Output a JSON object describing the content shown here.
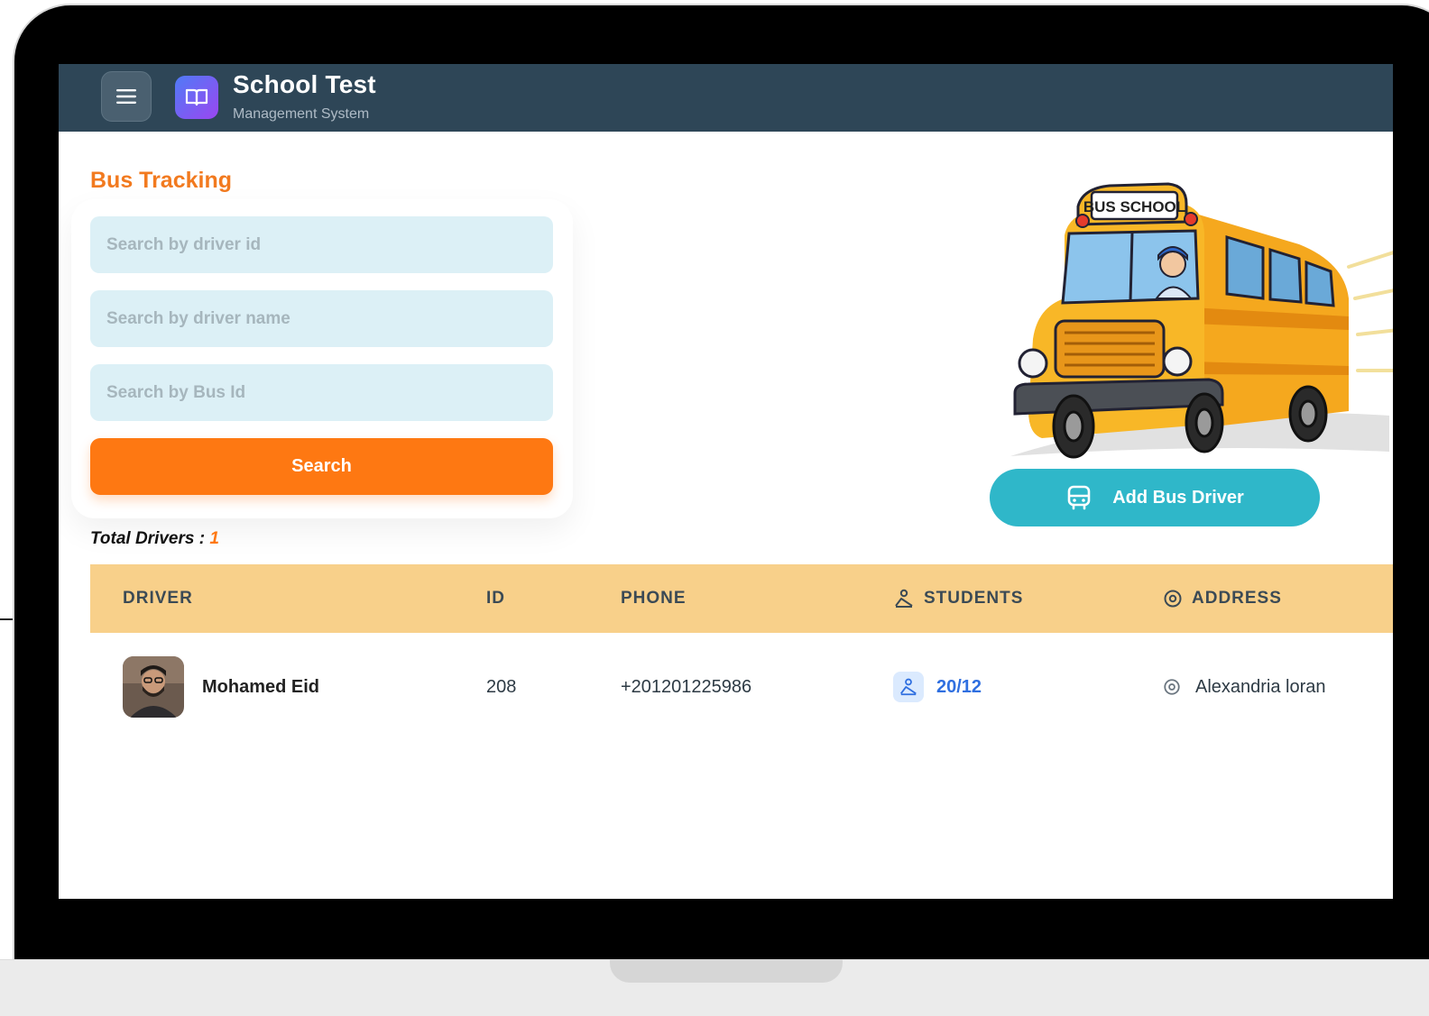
{
  "header": {
    "title": "School Test",
    "subtitle": "Management System"
  },
  "page": {
    "title": "Bus Tracking"
  },
  "search": {
    "driver_id_placeholder": "Search by driver id",
    "driver_name_placeholder": "Search by driver name",
    "bus_id_placeholder": "Search by Bus Id",
    "button_label": "Search"
  },
  "illustration": {
    "sign_text": "BUS SCHOOL"
  },
  "add_button": {
    "label": "Add Bus Driver"
  },
  "summary": {
    "total_label": "Total Drivers :",
    "total_count": "1"
  },
  "table": {
    "columns": [
      "DRIVER",
      "ID",
      "PHONE",
      "STUDENTS",
      "ADDRESS"
    ],
    "rows": [
      {
        "driver": "Mohamed Eid",
        "id": "208",
        "phone": "+201201225986",
        "students": "20/12",
        "address": "Alexandria loran"
      }
    ]
  },
  "icons": {
    "menu": "menu-icon",
    "logo": "book-icon",
    "bus": "bus-icon",
    "students": "students-icon",
    "address": "location-pin-icon"
  },
  "colors": {
    "header_bg": "#2e4657",
    "accent_orange": "#fe7812",
    "title_orange": "#f27a1f",
    "teal_button": "#2fb7c9",
    "table_head": "#f8d08a",
    "input_bg": "#dcf0f6",
    "link_blue": "#2f6fe0"
  }
}
